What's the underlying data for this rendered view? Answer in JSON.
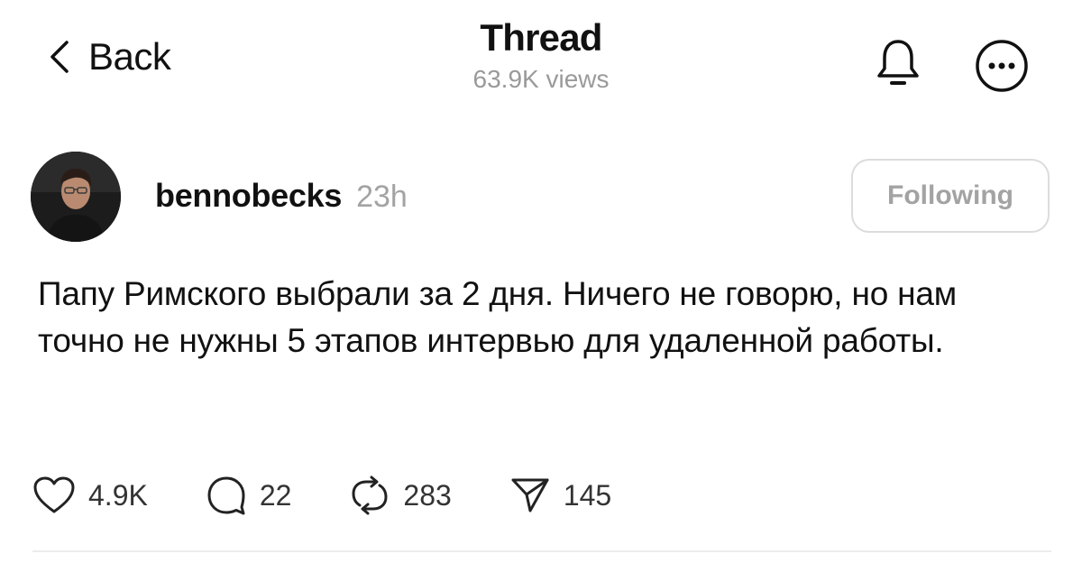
{
  "header": {
    "back_label": "Back",
    "title": "Thread",
    "views": "63.9K views"
  },
  "post": {
    "username": "bennobecks",
    "time_ago": "23h",
    "follow_label": "Following",
    "text": "Папу Римского выбрали за 2 дня. Ничего не говорю, но нам точно не нужны 5 этапов интервью для удаленной работы."
  },
  "stats": {
    "likes": "4.9K",
    "replies": "22",
    "reposts": "283",
    "shares": "145"
  },
  "icons": {
    "back": "chevron-left-icon",
    "bell": "bell-icon",
    "more": "more-horizontal-icon",
    "like": "heart-icon",
    "reply": "comment-icon",
    "repost": "repost-icon",
    "share": "send-icon"
  }
}
